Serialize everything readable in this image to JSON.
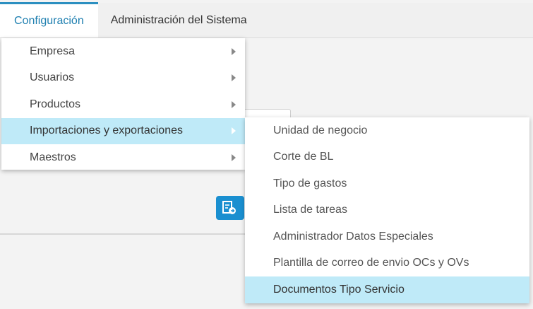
{
  "menubar": {
    "items": [
      {
        "label": "Configuración",
        "active": true
      },
      {
        "label": "Administración del Sistema",
        "active": false
      }
    ]
  },
  "config_menu": {
    "items": [
      {
        "label": "Empresa",
        "has_submenu": true
      },
      {
        "label": "Usuarios",
        "has_submenu": true
      },
      {
        "label": "Productos",
        "has_submenu": true
      },
      {
        "label": "Importaciones y exportaciones",
        "has_submenu": true,
        "highlighted": true
      },
      {
        "label": "Maestros",
        "has_submenu": true
      }
    ]
  },
  "import_export_submenu": {
    "items": [
      {
        "label": "Unidad de negocio"
      },
      {
        "label": "Corte de BL"
      },
      {
        "label": "Tipo de gastos"
      },
      {
        "label": "Lista de tareas"
      },
      {
        "label": "Administrador Datos Especiales"
      },
      {
        "label": "Plantilla de correo de envio OCs y OVs"
      },
      {
        "label": "Documentos Tipo Servicio",
        "highlighted": true
      }
    ]
  },
  "colors": {
    "accent": "#2b8fc0",
    "highlight": "#bfeaf8",
    "button": "#1a8fd0"
  }
}
